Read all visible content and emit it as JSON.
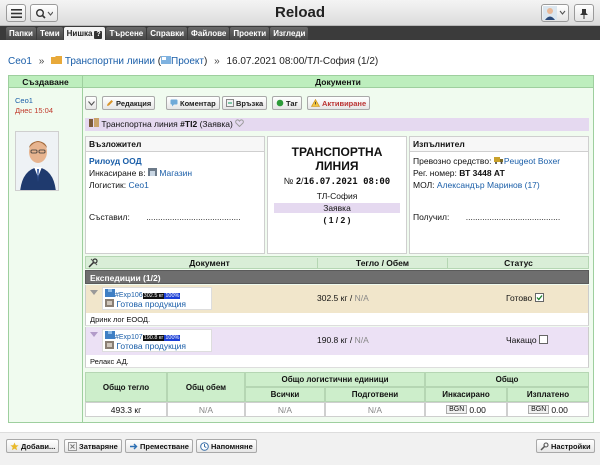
{
  "app": {
    "title": "Reload"
  },
  "menu": [
    {
      "label": "Папки"
    },
    {
      "label": "Теми"
    },
    {
      "label": "Нишка",
      "badge": "?"
    },
    {
      "label": "Търсене"
    },
    {
      "label": "Справки"
    },
    {
      "label": "Файлове"
    },
    {
      "label": "Проекти"
    },
    {
      "label": "Изгледи"
    }
  ],
  "breadcrumb": {
    "root": "Ceo1",
    "folder": "Транспортни линии",
    "project_paren_open": "(",
    "project": "Проект",
    "project_paren_close": ")",
    "sep": "»",
    "current": "16.07.2021 08:00/ТЛ-София (1/2)"
  },
  "columns": {
    "created": "Създаване",
    "documents": "Документи"
  },
  "author": {
    "name": "Ceo1",
    "time": "Днес 15:04"
  },
  "toolbar": {
    "edit": "Редакция",
    "comment": "Коментар",
    "link": "Връзка",
    "tag": "Таг",
    "activate": "Активиране"
  },
  "doc_title": "Транспортна линия",
  "doc_number": "#TI2",
  "doc_kind": "(Заявка)",
  "assignor": {
    "heading": "Възложител",
    "company": "Рилоуд ООД",
    "collection_label": "Инкасиране в:",
    "collection_value": "Магазин",
    "logistic_label": "Логистик:",
    "logistic_value": "Ceo1",
    "compiled_label": "Съставил:",
    "dots": "........................................"
  },
  "center": {
    "title_line1": "ТРАНСПОРТНА",
    "title_line2": "ЛИНИЯ",
    "number_prefix": "№",
    "number": "2",
    "slash": "/",
    "datetime": "16.07.2021 08:00",
    "location": "ТЛ-София",
    "kind": "Заявка",
    "fraction": "( 1 / 2 )"
  },
  "executor": {
    "heading": "Изпълнител",
    "vehicle_label": "Превозно средство:",
    "vehicle_value": "Peugeot Boxer",
    "reg_label": "Рег. номер:",
    "reg_value": "ВТ 3448 АТ",
    "mol_label": "МОЛ:",
    "mol_value": "Александър Маринов (17)",
    "received_label": "Получил:",
    "dots": "........................................"
  },
  "table_head": {
    "document": "Документ",
    "weight": "Тегло / Обем",
    "status": "Статус"
  },
  "expeditions": {
    "heading": "Експедиции (1/2)",
    "rows": [
      {
        "id": "#Exp106",
        "badge1": "302.5 кг",
        "badge2": "100%",
        "product": "Готова продукция",
        "weight": "302.5 кг",
        "slash": "/",
        "volume": "N/A",
        "status": "Готово",
        "checked": true,
        "client": "Дринк лог ЕООД."
      },
      {
        "id": "#Exp107",
        "badge1": "190.8 кг",
        "badge2": "100%",
        "product": "Готова продукция",
        "weight": "190.8 кг",
        "slash": "/",
        "volume": "N/A",
        "status": "Чакащо",
        "checked": false,
        "client": "Релакс АД."
      }
    ]
  },
  "totals": {
    "total_weight_label": "Общо тегло",
    "total_volume_label": "Общ обем",
    "logistic_units_label": "Общо логистични единици",
    "all_label": "Всички",
    "prepared_label": "Подготвени",
    "total_label": "Общо",
    "collected_label": "Инкасирано",
    "paid_label": "Изплатено",
    "total_weight": "493.3 кг",
    "total_volume": "N/A",
    "all": "N/A",
    "prepared": "N/A",
    "currency": "BGN",
    "collected": "0.00",
    "paid": "0.00"
  },
  "bottom": {
    "add": "Добави...",
    "close": "Затваряне",
    "move": "Преместване",
    "remind": "Напомняне",
    "settings": "Настройки"
  }
}
